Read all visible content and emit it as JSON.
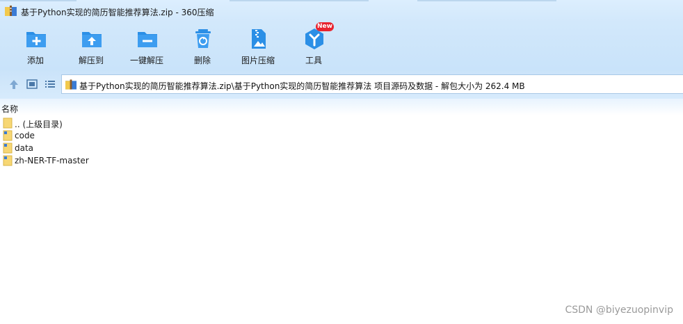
{
  "window": {
    "title": "基于Python实现的简历智能推荐算法.zip - 360压缩"
  },
  "toolbar": {
    "items": [
      {
        "label": "添加",
        "icon": "add-icon"
      },
      {
        "label": "解压到",
        "icon": "extract-to-icon"
      },
      {
        "label": "一键解压",
        "icon": "one-click-extract-icon"
      },
      {
        "label": "删除",
        "icon": "delete-icon"
      },
      {
        "label": "图片压缩",
        "icon": "image-compress-icon"
      },
      {
        "label": "工具",
        "icon": "tools-icon"
      }
    ],
    "new_badge": "New"
  },
  "address": {
    "path": "基于Python实现的简历智能推荐算法.zip\\基于Python实现的简历智能推荐算法 项目源码及数据 - 解包大小为 262.4 MB"
  },
  "list": {
    "column_name": "名称",
    "rows": [
      {
        "name": ".. (上级目录)",
        "icon": "parent-folder-icon"
      },
      {
        "name": "code",
        "icon": "folder-icon"
      },
      {
        "name": "data",
        "icon": "folder-icon"
      },
      {
        "name": "zh-NER-TF-master",
        "icon": "folder-icon"
      }
    ]
  },
  "watermark": "CSDN @biyezuopinvip",
  "colors": {
    "accent": "#2b8fe6",
    "badge": "#e8242f",
    "folder": "#f7d774"
  }
}
